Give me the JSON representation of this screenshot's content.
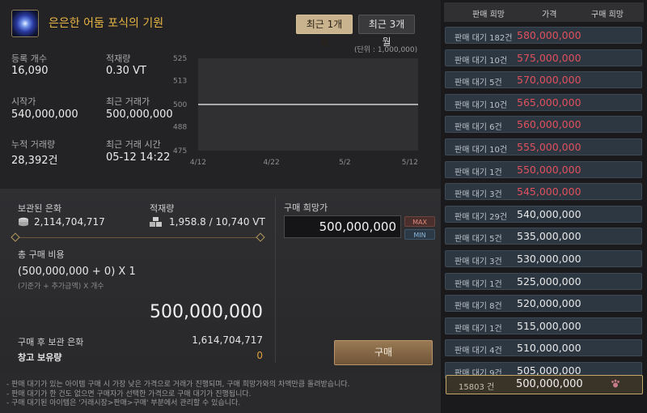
{
  "item": {
    "name": "은은한 어둠 포식의 기원",
    "icon": "dark-orb-icon"
  },
  "period_buttons": [
    "최근 1개월",
    "최근 3개월"
  ],
  "stats": {
    "reg_count_label": "등록 개수",
    "reg_count": "16,090",
    "load_label": "적재량",
    "load": "0.30 VT",
    "start_price_label": "시작가",
    "start_price": "540,000,000",
    "recent_price_label": "최근 거래가",
    "recent_price": "500,000,000",
    "total_trade_label": "누적 거래량",
    "total_trade": "28,392건",
    "recent_time_label": "최근 거래 시간",
    "recent_time": "05-12 14:22"
  },
  "chart_data": {
    "type": "line",
    "unit_note": "(단위 : 1,000,000)",
    "x_labels": [
      "4/12",
      "4/22",
      "5/2",
      "5/12"
    ],
    "y_labels": [
      "525",
      "513",
      "500",
      "488",
      "475"
    ],
    "ylim": [
      475,
      525
    ],
    "series": [
      {
        "values": [
          500,
          500,
          500,
          500
        ]
      }
    ]
  },
  "bottom": {
    "stored_silver_label": "보관된 은화",
    "stored_silver": "2,114,704,717",
    "load_label": "적재량",
    "load": "1,958.8 / 10,740 VT",
    "total_cost_label": "총 구매 비용",
    "formula": "(500,000,000 + 0) X 1",
    "formula_hint": "(기준가 + 추가금액) X 개수",
    "total": "500,000,000",
    "after_label": "구매 후 보관 은화",
    "after_value": "1,614,704,717",
    "warehouse_label": "창고 보유량",
    "warehouse_value": "0",
    "desired_label": "구매 희망가",
    "desired_value": "500,000,000",
    "max_label": "MAX",
    "min_label": "MIN",
    "buy_label": "구매"
  },
  "notes": [
    "- 판매 대기가 있는 아이템 구매 시 가장 낮은 가격으로 거래가 진행되며, 구매 희망가와의 차액만큼 돌려받습니다.",
    "- 판매 대기가 한 건도 없으면 구매자가 선택한 가격으로 구매 대기가 진행됩니다.",
    "- 구매 대기된 아이템은 '거래시장>판매>구매' 부분에서 관리할 수 있습니다."
  ],
  "orderbook": {
    "headers": [
      "판매 희망",
      "가격",
      "구매 희망"
    ],
    "colors": {
      "sell": "#e0505c",
      "neutral": "#e8e8e8"
    },
    "rows": [
      {
        "qty": "판매 대기 182건",
        "price": "580,000,000",
        "tone": "sell"
      },
      {
        "qty": "판매 대기 10건",
        "price": "575,000,000",
        "tone": "sell"
      },
      {
        "qty": "판매 대기 5건",
        "price": "570,000,000",
        "tone": "sell"
      },
      {
        "qty": "판매 대기 10건",
        "price": "565,000,000",
        "tone": "sell"
      },
      {
        "qty": "판매 대기 6건",
        "price": "560,000,000",
        "tone": "sell"
      },
      {
        "qty": "판매 대기 10건",
        "price": "555,000,000",
        "tone": "sell"
      },
      {
        "qty": "판매 대기 1건",
        "price": "550,000,000",
        "tone": "sell"
      },
      {
        "qty": "판매 대기 3건",
        "price": "545,000,000",
        "tone": "sell"
      },
      {
        "qty": "판매 대기 29건",
        "price": "540,000,000",
        "tone": "neutral"
      },
      {
        "qty": "판매 대기 5건",
        "price": "535,000,000",
        "tone": "neutral"
      },
      {
        "qty": "판매 대기 3건",
        "price": "530,000,000",
        "tone": "neutral"
      },
      {
        "qty": "판매 대기 1건",
        "price": "525,000,000",
        "tone": "neutral"
      },
      {
        "qty": "판매 대기 8건",
        "price": "520,000,000",
        "tone": "neutral"
      },
      {
        "qty": "판매 대기 1건",
        "price": "515,000,000",
        "tone": "neutral"
      },
      {
        "qty": "판매 대기 4건",
        "price": "510,000,000",
        "tone": "neutral"
      },
      {
        "qty": "판매 대기 9건",
        "price": "505,000,000",
        "tone": "neutral"
      }
    ],
    "mine": {
      "qty": "15803 건",
      "price": "500,000,000",
      "icon": "bear-paw-icon"
    }
  }
}
